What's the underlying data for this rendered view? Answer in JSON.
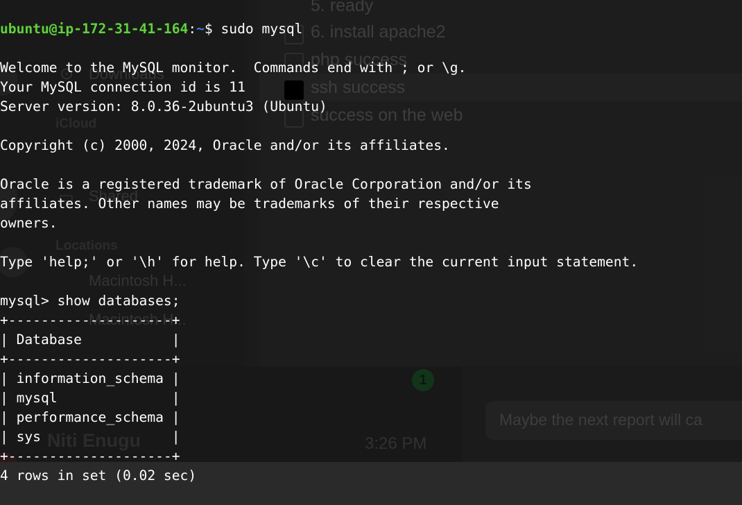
{
  "terminal": {
    "prompt_user": "ubuntu@ip-172-31-41-164",
    "prompt_colon": ":",
    "prompt_path": "~",
    "prompt_symbol": "$ ",
    "command": "sudo mysql",
    "lines": [
      "Welcome to the MySQL monitor.  Commands end with ; or \\g.",
      "Your MySQL connection id is 11",
      "Server version: 8.0.36-2ubuntu3 (Ubuntu)",
      "",
      "Copyright (c) 2000, 2024, Oracle and/or its affiliates.",
      "",
      "Oracle is a registered trademark of Oracle Corporation and/or its",
      "affiliates. Other names may be trademarks of their respective",
      "owners.",
      "",
      "Type 'help;' or '\\h' for help. Type '\\c' to clear the current input statement.",
      "",
      "mysql> show databases;",
      "+--------------------+",
      "| Database           |",
      "+--------------------+",
      "| information_schema |",
      "| mysql              |",
      "| performance_schema |",
      "| sys                |",
      "+--------------------+",
      "4 rows in set (0.02 sec)"
    ]
  },
  "background": {
    "sidebar": {
      "downloads": "Downloads",
      "icloud": "iCloud",
      "shared": "Shared",
      "locations": "Locations",
      "location_items": [
        "Macintosh H...",
        "Macintosh H..."
      ]
    },
    "list": {
      "items": [
        "5. ready",
        "6. install apache2",
        "php success",
        "ssh success",
        "success on the web"
      ]
    },
    "chat": {
      "badge": "1",
      "message": "Maybe the next report will ca",
      "time": "3:26 PM",
      "name": "Niti Enugu"
    }
  },
  "colors": {
    "prompt_user": "#5fd23a",
    "prompt_path": "#3f7fe6",
    "terminal_text": "#ffffff"
  }
}
